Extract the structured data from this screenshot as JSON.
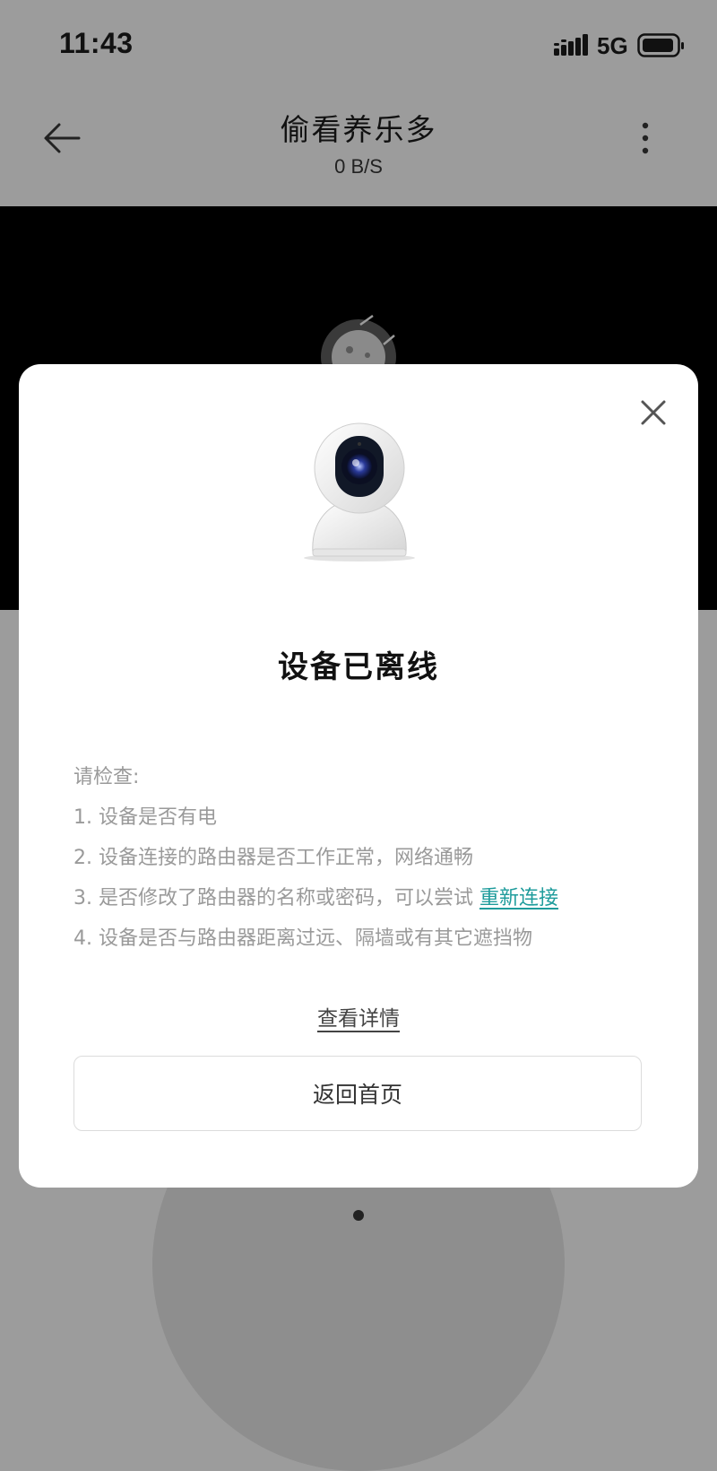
{
  "status_bar": {
    "time": "11:43",
    "network": "5G",
    "icons": [
      "signal-icon",
      "battery-icon"
    ]
  },
  "nav": {
    "title": "偷看养乐多",
    "subtitle": "0 B/S",
    "icons": [
      "back-arrow-icon",
      "more-vertical-icon"
    ]
  },
  "video": {
    "state_icon": "offline-device-icon"
  },
  "dialog": {
    "image": "camera-device-image",
    "title": "设备已离线",
    "check_header": "请检查:",
    "items": [
      "1. 设备是否有电",
      "2. 设备连接的路由器是否工作正常，网络通畅",
      "3. 是否修改了路由器的名称或密码，可以尝试",
      "4. 设备是否与路由器距离过远、隔墙或有其它遮挡物"
    ],
    "reconnect_link": "重新连接",
    "details_link": "查看详情",
    "home_button": "返回首页",
    "close_icon": "close-icon"
  },
  "colors": {
    "overlay_background": "#9c9c9c",
    "video_background": "#000000",
    "dialog_background": "#ffffff",
    "link_accent": "#1f9c9c",
    "muted_text": "#9a9a9a"
  }
}
